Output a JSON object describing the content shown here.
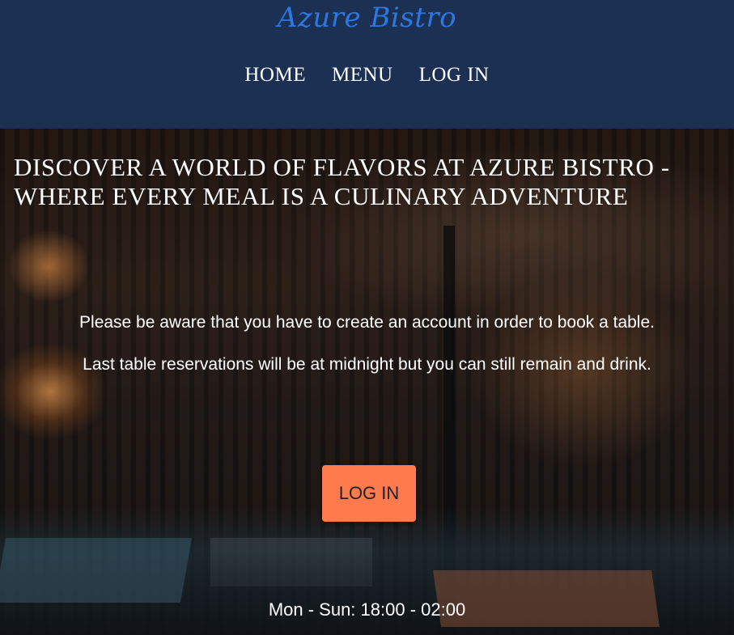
{
  "brand": {
    "name": "Azure Bistro",
    "color": "#2a78e0"
  },
  "nav": {
    "items": [
      {
        "label": "HOME"
      },
      {
        "label": "MENU"
      },
      {
        "label": "LOG IN"
      }
    ]
  },
  "hero": {
    "headline_line1": "DISCOVER A WORLD OF FLAVORS AT AZURE BISTRO -",
    "headline_line2": "WHERE EVERY MEAL IS A CULINARY ADVENTURE",
    "notice_account": "Please be aware that you have to create an account in order to book a table.",
    "notice_last_reservation": "Last table reservations will be at midnight but you can still remain and drink.",
    "login_button": "LOG IN",
    "opening_hours": "Mon - Sun: 18:00 - 02:00"
  },
  "colors": {
    "header_bg": "#1c3053",
    "button_bg": "#ff7a4d",
    "text": "#ffffff"
  }
}
